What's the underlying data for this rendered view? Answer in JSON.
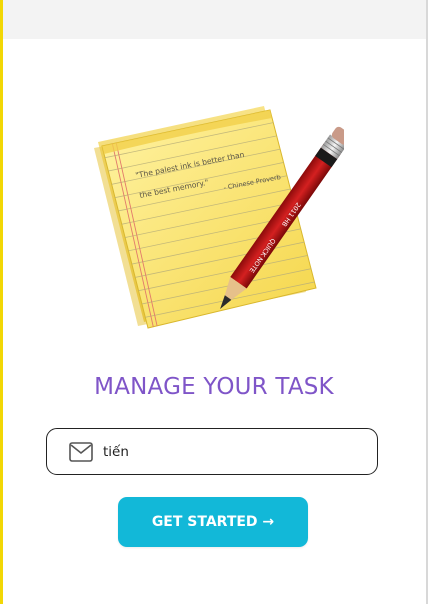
{
  "header": {},
  "illustration": {
    "icon": "notepad-pencil-icon",
    "quote_line1": "\"The palest ink is better than",
    "quote_line2": "the best memory.\"",
    "quote_author": "- Chinese Proverb",
    "pencil_brand": "QUICK NOTE",
    "pencil_code": "2011 HB"
  },
  "main": {
    "title": "MANAGE YOUR TASK",
    "email_value": "tiến",
    "email_icon": "mail-icon",
    "start_label": "GET STARTED →"
  },
  "colors": {
    "accent": "#7f55c8",
    "button": "#12b8d8",
    "frame": "#f2d705"
  }
}
